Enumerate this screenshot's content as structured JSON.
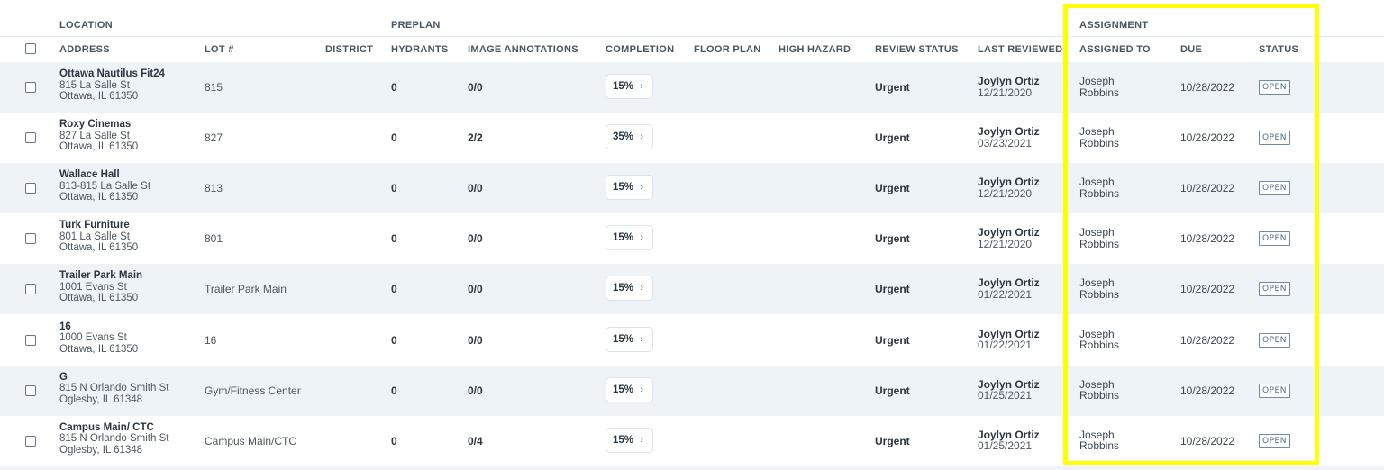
{
  "groups": {
    "location": "LOCATION",
    "preplan": "PREPLAN",
    "assignment": "ASSIGNMENT"
  },
  "columns": {
    "address": "ADDRESS",
    "lot": "LOT #",
    "district": "DISTRICT",
    "hydrants": "HYDRANTS",
    "image_annotations": "IMAGE ANNOTATIONS",
    "completion": "COMPLETION",
    "floor_plan": "FLOOR PLAN",
    "high_hazard": "HIGH HAZARD",
    "review_status": "REVIEW STATUS",
    "last_reviewed": "LAST REVIEWED",
    "assigned_to": "ASSIGNED TO",
    "due": "DUE",
    "status": "STATUS"
  },
  "rows": [
    {
      "name": "Ottawa Nautilus Fit24",
      "street": "815 La Salle St",
      "city": "Ottawa, IL 61350",
      "lot": "815",
      "hydrants": "0",
      "annotations": "0/0",
      "completion": "15%",
      "review": "Urgent",
      "reviewer": "Joylyn Ortiz",
      "reviewed": "12/21/2020",
      "assignee_first": "Joseph",
      "assignee_last": "Robbins",
      "due": "10/28/2022",
      "status": "OPEN"
    },
    {
      "name": "Roxy Cinemas",
      "street": "827 La Salle St",
      "city": "Ottawa, IL 61350",
      "lot": "827",
      "hydrants": "0",
      "annotations": "2/2",
      "completion": "35%",
      "review": "Urgent",
      "reviewer": "Joylyn Ortiz",
      "reviewed": "03/23/2021",
      "assignee_first": "Joseph",
      "assignee_last": "Robbins",
      "due": "10/28/2022",
      "status": "OPEN"
    },
    {
      "name": "Wallace Hall",
      "street": "813-815 La Salle St",
      "city": "Ottawa, IL 61350",
      "lot": "813",
      "hydrants": "0",
      "annotations": "0/0",
      "completion": "15%",
      "review": "Urgent",
      "reviewer": "Joylyn Ortiz",
      "reviewed": "12/21/2020",
      "assignee_first": "Joseph",
      "assignee_last": "Robbins",
      "due": "10/28/2022",
      "status": "OPEN"
    },
    {
      "name": "Turk Furniture",
      "street": "801 La Salle St",
      "city": "Ottawa, IL 61350",
      "lot": "801",
      "hydrants": "0",
      "annotations": "0/0",
      "completion": "15%",
      "review": "Urgent",
      "reviewer": "Joylyn Ortiz",
      "reviewed": "12/21/2020",
      "assignee_first": "Joseph",
      "assignee_last": "Robbins",
      "due": "10/28/2022",
      "status": "OPEN"
    },
    {
      "name": "Trailer Park Main",
      "street": "1001 Evans St",
      "city": "Ottawa, IL 61350",
      "lot": "Trailer Park Main",
      "hydrants": "0",
      "annotations": "0/0",
      "completion": "15%",
      "review": "Urgent",
      "reviewer": "Joylyn Ortiz",
      "reviewed": "01/22/2021",
      "assignee_first": "Joseph",
      "assignee_last": "Robbins",
      "due": "10/28/2022",
      "status": "OPEN"
    },
    {
      "name": "16",
      "street": "1000 Evans St",
      "city": "Ottawa, IL 61350",
      "lot": "16",
      "hydrants": "0",
      "annotations": "0/0",
      "completion": "15%",
      "review": "Urgent",
      "reviewer": "Joylyn Ortiz",
      "reviewed": "01/22/2021",
      "assignee_first": "Joseph",
      "assignee_last": "Robbins",
      "due": "10/28/2022",
      "status": "OPEN"
    },
    {
      "name": "G",
      "street": "815 N Orlando Smith St",
      "city": "Oglesby, IL 61348",
      "lot": "Gym/Fitness Center",
      "hydrants": "0",
      "annotations": "0/0",
      "completion": "15%",
      "review": "Urgent",
      "reviewer": "Joylyn Ortiz",
      "reviewed": "01/25/2021",
      "assignee_first": "Joseph",
      "assignee_last": "Robbins",
      "due": "10/28/2022",
      "status": "OPEN"
    },
    {
      "name": "Campus Main/ CTC",
      "street": "815 N Orlando Smith St",
      "city": "Oglesby, IL 61348",
      "lot": "Campus Main/CTC",
      "hydrants": "0",
      "annotations": "0/4",
      "completion": "15%",
      "review": "Urgent",
      "reviewer": "Joylyn Ortiz",
      "reviewed": "01/25/2021",
      "assignee_first": "Joseph",
      "assignee_last": "Robbins",
      "due": "10/28/2022",
      "status": "OPEN"
    }
  ],
  "icons": {
    "completion_chevron": "chevron-right-icon",
    "checkbox": "checkbox-icon"
  },
  "colors": {
    "highlight": "#ffff00",
    "row_alt": "#eef3f8",
    "status_border": "#6f8aa6"
  }
}
